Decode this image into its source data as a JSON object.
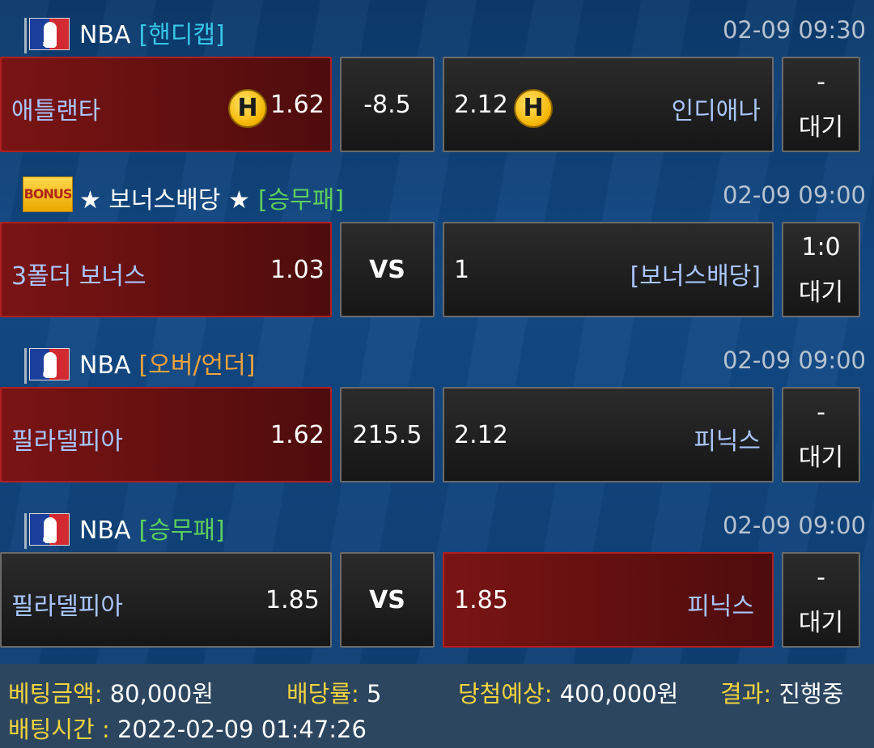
{
  "matches": [
    {
      "league": "NBA",
      "bet_type": "[핸디캡]",
      "time": "02-09 09:30",
      "home": {
        "name": "애틀랜타",
        "odds": "1.62",
        "badge": "H"
      },
      "middle": "-8.5",
      "away": {
        "name": "인디애나",
        "odds": "2.12",
        "badge": "H"
      },
      "status": {
        "line1": "-",
        "line2": "대기"
      }
    },
    {
      "league": "★ 보너스배당 ★",
      "league_logo_text": "BONUS",
      "bet_type": "[승무패]",
      "time": "02-09 09:00",
      "home": {
        "name": "3폴더 보너스",
        "odds": "1.03"
      },
      "middle": "VS",
      "away": {
        "name": "[보너스배당]",
        "odds": "1"
      },
      "status": {
        "line1": "1:0",
        "line2": "대기"
      }
    },
    {
      "league": "NBA",
      "bet_type": "[오버/언더]",
      "time": "02-09 09:00",
      "home": {
        "name": "필라델피아",
        "odds": "1.62"
      },
      "middle": "215.5",
      "away": {
        "name": "피닉스",
        "odds": "2.12"
      },
      "status": {
        "line1": "-",
        "line2": "대기"
      }
    },
    {
      "league": "NBA",
      "bet_type": "[승무패]",
      "time": "02-09 09:00",
      "home": {
        "name": "필라델피아",
        "odds": "1.85"
      },
      "middle": "VS",
      "away": {
        "name": "피닉스",
        "odds": "1.85"
      },
      "status": {
        "line1": "-",
        "line2": "대기"
      }
    }
  ],
  "nba_logo_text": "NBA",
  "summary": {
    "bet_amount_label": "베팅금액:",
    "bet_amount": "80,000원",
    "odds_label": "배당률:",
    "odds": "5",
    "expected_label": "당첨예상:",
    "expected": "400,000원",
    "result_label": "결과:",
    "result": "진행중",
    "bet_time_label": "배팅시간 :",
    "bet_time": "2022-02-09 01:47:26"
  },
  "colors": {
    "selected": "#7a1414",
    "handicap_tag": "#36c6e6",
    "win_draw_tag": "#5ccf5c",
    "over_under_tag": "#f0a23a",
    "label_yellow": "#f2d33c"
  },
  "icons": {
    "handicap_badge": "h-badge-icon",
    "league_logo": "nba-logo-icon"
  }
}
